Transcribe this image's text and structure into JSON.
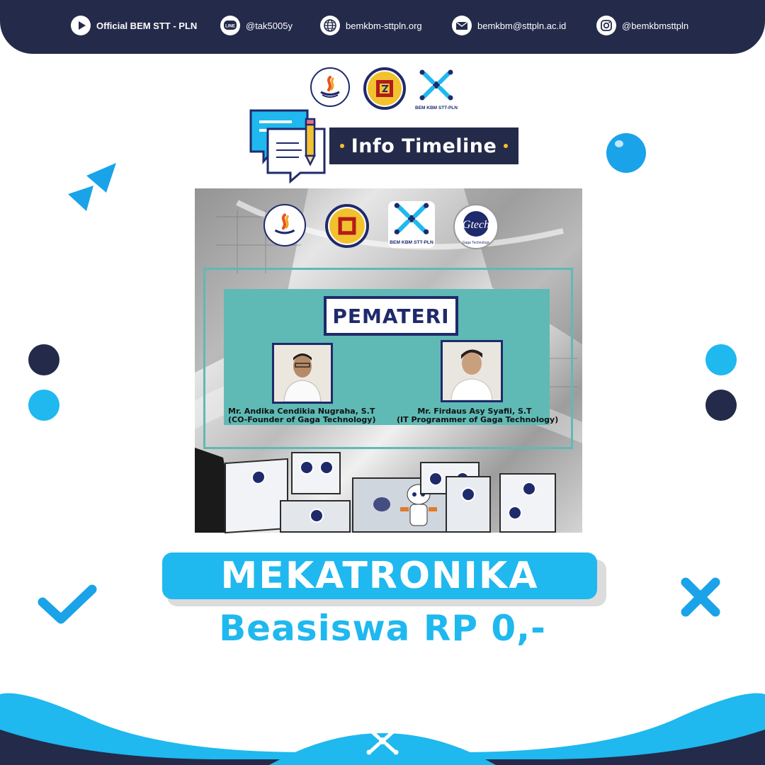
{
  "header": {
    "items": [
      {
        "icon": "play-icon",
        "label": "Official BEM STT - PLN"
      },
      {
        "icon": "line-icon",
        "label": "@tak5005y"
      },
      {
        "icon": "globe-icon",
        "label": "bemkbm-sttpln.org"
      },
      {
        "icon": "mail-icon",
        "label": "bemkbm@sttpln.ac.id"
      },
      {
        "icon": "instagram-icon",
        "label": "@bemkbmsttpln"
      }
    ]
  },
  "logos": {
    "top": [
      "stt-pln-logo",
      "kbm-stt-pln-logo",
      "bem-kbm-stt-pln-logo"
    ],
    "bem_label": "BEM KBM STT-PLN",
    "gtech_label": "Gaga Technology",
    "gtech_mark": "Gtech"
  },
  "banner": {
    "title": "Info Timeline"
  },
  "poster": {
    "heading": "PEMATERI",
    "speakers": [
      {
        "name": "Mr. Andika Cendikia Nugraha, S.T",
        "role": "(CO-Founder of Gaga Technology)"
      },
      {
        "name": "Mr. Firdaus Asy Syafii, S.T",
        "role": "(IT Programmer of Gaga Technology)"
      }
    ]
  },
  "headline": {
    "title": "MEKATRONIKA",
    "subtitle": "Beasiswa RP 0,-"
  },
  "colors": {
    "navy": "#242a4a",
    "cyan": "#1fb8ef",
    "teal": "#5fbab5",
    "light_blue": "#1aa3e8"
  }
}
